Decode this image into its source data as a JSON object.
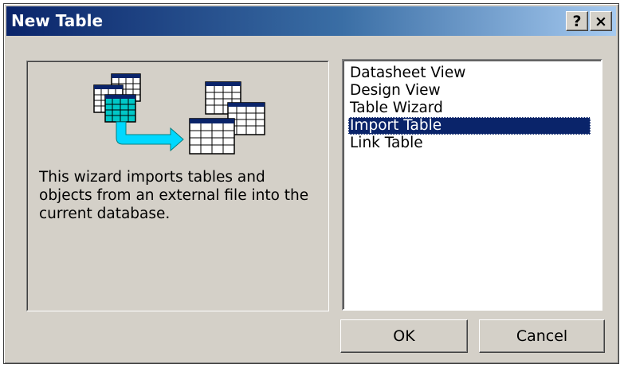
{
  "window": {
    "title": "New Table",
    "help_label": "?",
    "close_label": "×"
  },
  "description": "This wizard imports tables and objects from an external file into the current database.",
  "list": {
    "items": [
      "Datasheet View",
      "Design View",
      "Table Wizard",
      "Import Table",
      "Link Table"
    ],
    "selected": "Import Table"
  },
  "buttons": {
    "ok": "OK",
    "cancel": "Cancel"
  },
  "colors": {
    "title_start": "#0a246a",
    "title_end": "#a6caf0",
    "selection": "#0a246a",
    "face": "#d4d0c8"
  }
}
